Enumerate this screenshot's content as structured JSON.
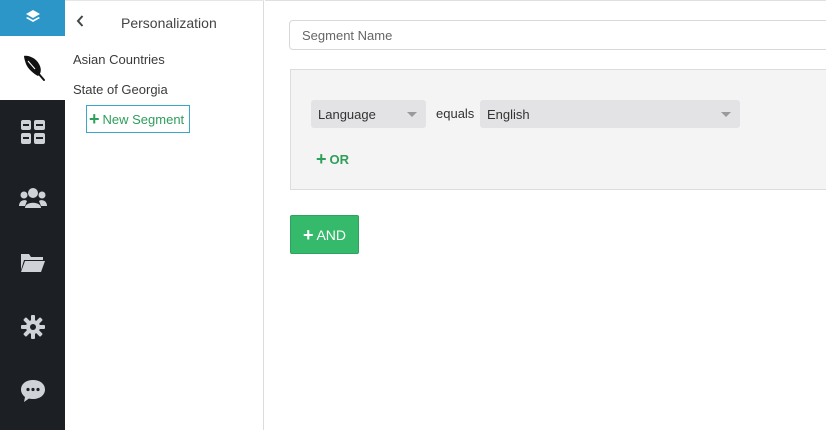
{
  "rail": {
    "icons": [
      "layers-icon",
      "feather-icon",
      "dashboard-grid-icon",
      "users-icon",
      "folder-icon",
      "gear-icon",
      "chat-icon"
    ],
    "accent": "#2d96c8",
    "background": "#1c1f24"
  },
  "sidebar": {
    "title": "Personalization",
    "segments": [
      "Asian Countries",
      "State of Georgia"
    ],
    "new_segment_label": "New Segment",
    "new_segment_plus": "+"
  },
  "main": {
    "segment_name_placeholder": "Segment Name",
    "rule": {
      "field": "Language",
      "operator": "equals",
      "value": "English"
    },
    "or_label": "OR",
    "or_plus": "+",
    "and_label": "AND",
    "and_plus": "+",
    "accent_green": "#35b96a"
  }
}
